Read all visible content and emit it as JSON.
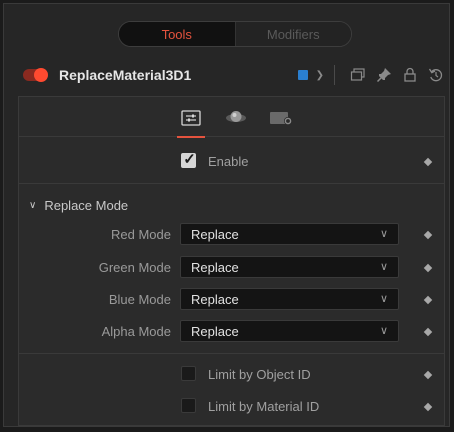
{
  "tabs": {
    "tools": "Tools",
    "modifiers": "Modifiers"
  },
  "node": {
    "name": "ReplaceMaterial3D1",
    "color_swatch": "#2a7fd0"
  },
  "panel": {
    "icon_tabs": [
      "controls-tab-icon",
      "material-tab-icon",
      "settings-tab-icon"
    ],
    "enable": {
      "label": "Enable",
      "checked": true
    },
    "section": {
      "title": "Replace Mode",
      "expanded": true
    },
    "modes": [
      {
        "label": "Red Mode",
        "value": "Replace"
      },
      {
        "label": "Green Mode",
        "value": "Replace"
      },
      {
        "label": "Blue Mode",
        "value": "Replace"
      },
      {
        "label": "Alpha Mode",
        "value": "Replace"
      }
    ],
    "limit_object": {
      "label": "Limit by Object ID",
      "checked": false
    },
    "limit_material": {
      "label": "Limit by Material ID",
      "checked": false
    }
  },
  "colors": {
    "accent": "#e5533e",
    "toggle_on": "#ff4a30"
  }
}
